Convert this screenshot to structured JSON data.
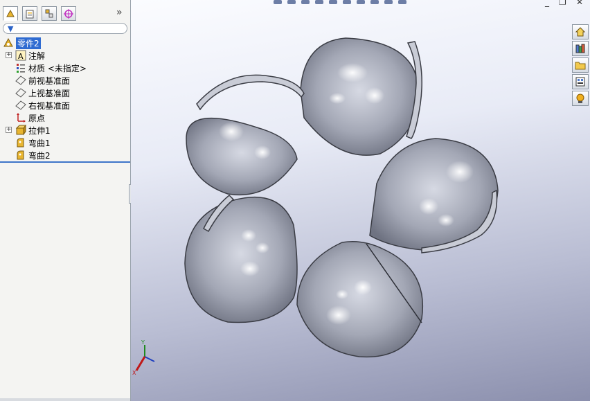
{
  "feature_tree": {
    "root": "零件2",
    "items": [
      {
        "label": "注解",
        "expandable": true,
        "icon": "annotation-icon"
      },
      {
        "label": "材质 <未指定>",
        "expandable": false,
        "icon": "material-icon"
      },
      {
        "label": "前视基准面",
        "expandable": false,
        "icon": "plane-icon"
      },
      {
        "label": "上视基准面",
        "expandable": false,
        "icon": "plane-icon"
      },
      {
        "label": "右视基准面",
        "expandable": false,
        "icon": "plane-icon"
      },
      {
        "label": "原点",
        "expandable": false,
        "icon": "origin-icon"
      },
      {
        "label": "拉伸1",
        "expandable": true,
        "icon": "extrude-icon"
      },
      {
        "label": "弯曲1",
        "expandable": false,
        "icon": "flex-icon"
      },
      {
        "label": "弯曲2",
        "expandable": false,
        "icon": "flex-icon"
      }
    ]
  },
  "panel_tabs": [
    "featuremanager-icon",
    "propertymanager-icon",
    "configurationmanager-icon",
    "dimxpert-icon"
  ],
  "task_pane": [
    "home-icon",
    "design-library-icon",
    "file-explorer-icon",
    "view-palette-icon",
    "appearances-icon"
  ],
  "colors": {
    "accent": "#2f6bd1",
    "model": "#9ea3b1"
  }
}
